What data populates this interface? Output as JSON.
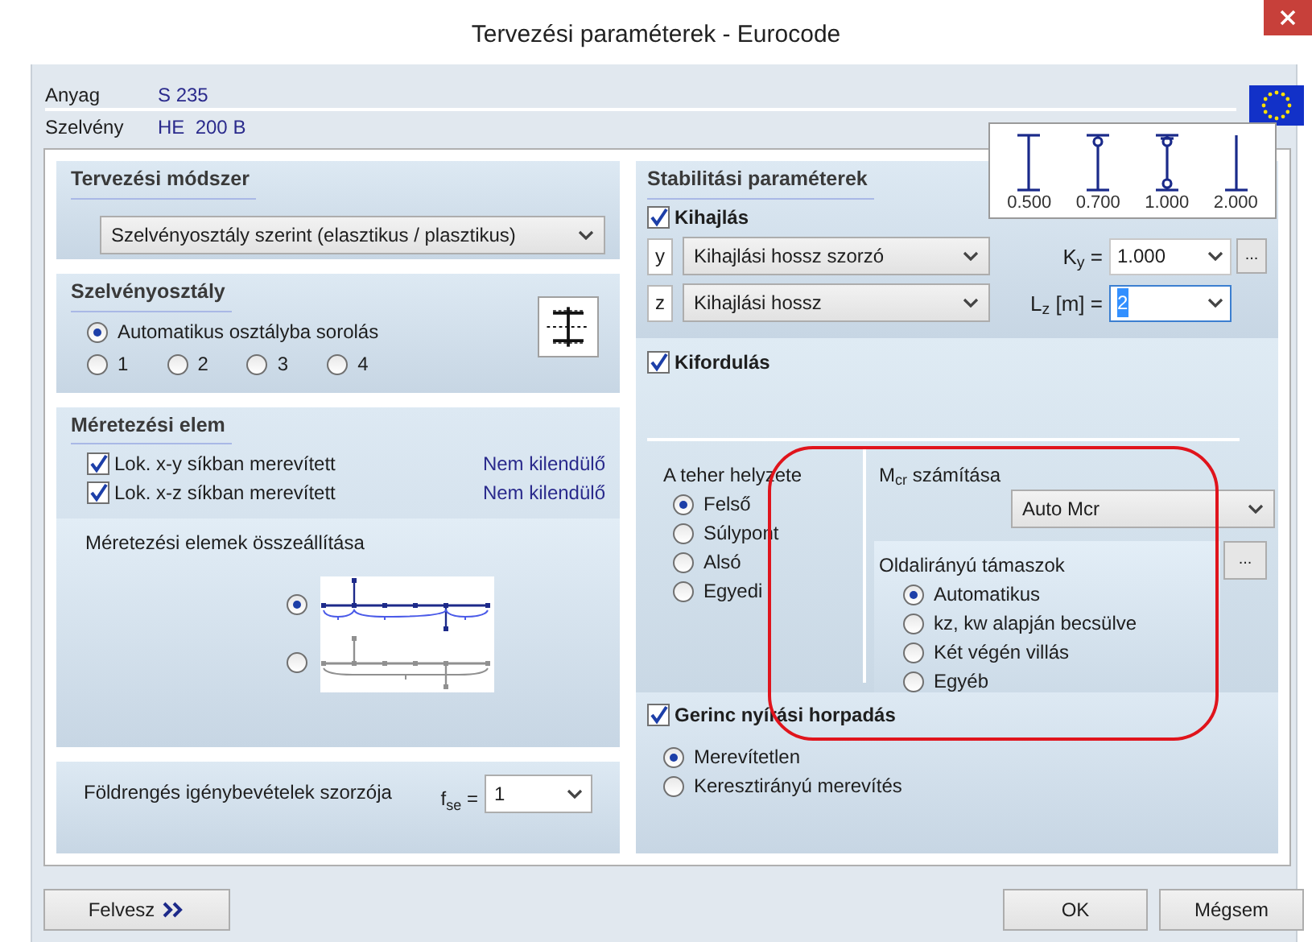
{
  "window": {
    "title": "Tervezési paraméterek - Eurocode"
  },
  "info": [
    {
      "label": "Anyag",
      "value": "S 235"
    },
    {
      "label": "Szelvény",
      "value": "HE  200 B"
    }
  ],
  "design_method": {
    "title": "Tervezési módszer",
    "value": "Szelvényosztály szerint (elasztikus / plasztikus)"
  },
  "section_class": {
    "title": "Szelvényosztály",
    "options": [
      {
        "label": "Automatikus osztályba sorolás",
        "selected": true
      },
      {
        "label": "1",
        "selected": false
      },
      {
        "label": "2",
        "selected": false
      },
      {
        "label": "3",
        "selected": false
      },
      {
        "label": "4",
        "selected": false
      }
    ]
  },
  "design_member": {
    "title": "Méretezési elem",
    "items": [
      {
        "label": "Lok. x-y síkban merevített",
        "checked": true,
        "status": "Nem kilendülő"
      },
      {
        "label": "Lok. x-z síkban merevített",
        "checked": true,
        "status": "Nem kilendülő"
      }
    ],
    "assembly_title": "Méretezési elemek összeállítása",
    "assembly_options": [
      {
        "kind": "segmented",
        "selected": true
      },
      {
        "kind": "whole",
        "selected": false
      }
    ]
  },
  "seismic": {
    "label": "Földrengés igénybevételek szorzója",
    "symbol": "f$_{se}$ =",
    "value": "1"
  },
  "stability": {
    "title": "Stabilitási paraméterek",
    "factor_legend": [
      {
        "kind": "fixed-fixed",
        "label": "0.500"
      },
      {
        "kind": "fixed-pinned",
        "label": "0.700"
      },
      {
        "kind": "pinned-pinned",
        "label": "1.000"
      },
      {
        "kind": "cantilever",
        "label": "2.000"
      }
    ],
    "buckling": {
      "label": "Kihajlás",
      "checked": true,
      "rows": [
        {
          "axis": "y",
          "method": "Kihajlási hossz szorzó",
          "param": "K$_{y}$ =",
          "value": "1.000",
          "more": "...",
          "focused": false
        },
        {
          "axis": "z",
          "method": "Kihajlási hossz",
          "param": "L$_{z}$ [m] =",
          "value": "2",
          "focused": true
        }
      ]
    },
    "lateral_torsional": {
      "label": "Kifordulás",
      "checked": true,
      "load_position": {
        "title": "A teher helyzete",
        "options": [
          {
            "label": "Felső",
            "selected": true
          },
          {
            "label": "Súlypont",
            "selected": false
          },
          {
            "label": "Alsó",
            "selected": false
          },
          {
            "label": "Egyedi",
            "selected": false
          }
        ]
      },
      "mcr": {
        "title": "M$_{cr}$ számítása",
        "value": "Auto Mcr",
        "supports_title": "Oldalirányú támaszok",
        "more": "...",
        "options": [
          {
            "label": "Automatikus",
            "selected": true
          },
          {
            "label": "kz, kw alapján becsülve",
            "selected": false
          },
          {
            "label": "Két végén villás",
            "selected": false
          },
          {
            "label": "Egyéb",
            "selected": false
          }
        ]
      }
    },
    "web_shear": {
      "label": "Gerinc nyírási horpadás",
      "checked": true,
      "options": [
        {
          "label": "Merevítetlen",
          "selected": true
        },
        {
          "label": "Keresztirányú merevítés",
          "selected": false
        }
      ]
    }
  },
  "buttons": [
    {
      "kind": "add",
      "label": "Felvesz"
    },
    {
      "kind": "ok",
      "label": "OK"
    },
    {
      "kind": "cancel",
      "label": "Mégsem"
    }
  ]
}
